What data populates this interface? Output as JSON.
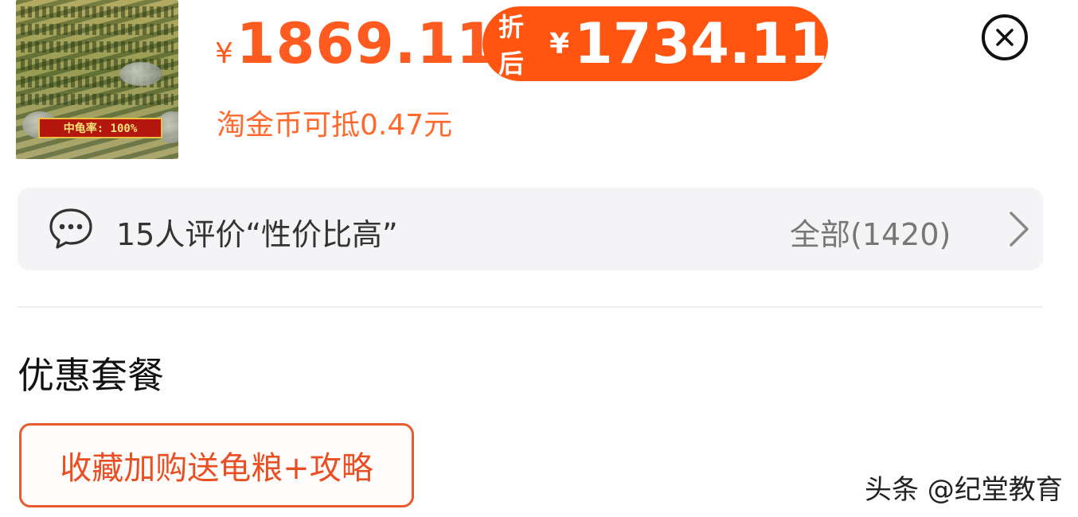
{
  "product": {
    "thumbnail_badge": "中龟率: 100%",
    "original_price_currency": "¥",
    "original_price": "1869.11",
    "discount_tag": "折后",
    "discount_currency": "¥",
    "discount_price": "1734.11",
    "coin_note": "淘金币可抵0.47元"
  },
  "review": {
    "summary": "15人评价“性价比高”",
    "all_label": "全部(1420)"
  },
  "section": {
    "title": "优惠套餐"
  },
  "combo": {
    "label": "收藏加购送龟粮+攻略"
  },
  "watermark": {
    "text": "头条 @纪堂教育"
  },
  "colors": {
    "accent": "#ff5511",
    "price_text": "#ff5a1f",
    "combo_border": "#ea5a2f"
  },
  "icons": {
    "close": "close-circle-icon",
    "chat": "chat-bubble-icon",
    "chevron": "chevron-right-icon"
  }
}
